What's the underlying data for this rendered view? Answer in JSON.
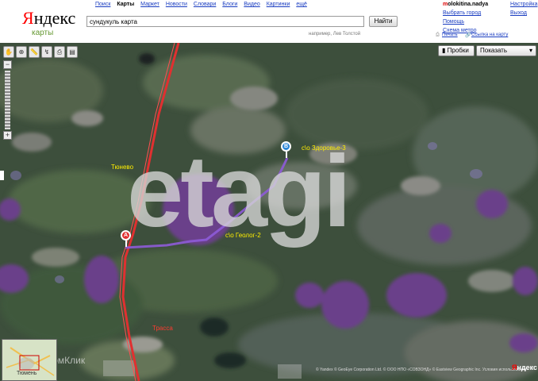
{
  "header": {
    "logo_text": "Яндекс",
    "logo_subtitle": "карты",
    "services": [
      {
        "label": "Поиск",
        "active": false
      },
      {
        "label": "Карты",
        "active": true
      },
      {
        "label": "Маркет",
        "active": false
      },
      {
        "label": "Новости",
        "active": false
      },
      {
        "label": "Словари",
        "active": false
      },
      {
        "label": "Блоги",
        "active": false
      },
      {
        "label": "Видео",
        "active": false
      },
      {
        "label": "Картинки",
        "active": false
      },
      {
        "label": "ещё",
        "active": false
      }
    ],
    "search_value": "сундукуль карта",
    "search_button": "Найти",
    "search_example": "например, Лев Толстой",
    "user_first_letter": "m",
    "user_rest": "olokitina.nadya",
    "links": {
      "settings": "Настройка",
      "exit": "Выход",
      "choose_city": "Выбрать город",
      "help": "Помощь",
      "metro": "Схема метро",
      "print": "Печать",
      "link_to_map": "Ссылка на карту"
    }
  },
  "map": {
    "layer_buttons": {
      "traffic": "Пробки",
      "show": "Показать"
    },
    "labels": [
      {
        "id": "zdorovye",
        "text": "с\\о Здоровье-3",
        "color": "#ffee00"
      },
      {
        "id": "tyunevo",
        "text": "Тюнево",
        "color": "#ffee00"
      },
      {
        "id": "geolog",
        "text": "с\\о Геолог-2",
        "color": "#ffee00"
      },
      {
        "id": "trassa",
        "text": "Трасса",
        "color": "#ff3b30"
      }
    ],
    "markers": [
      {
        "letter": "B",
        "color": "#2a86d6"
      },
      {
        "letter": "A",
        "color": "#e03030"
      }
    ],
    "copyright": "© Yandex  © GeoEye Corporation Ltd.  © ООО НПО «СОВЗОНД»  ©  Eastview Geographic Inc.  Условия использования",
    "yandex_logo_first": "Я",
    "yandex_logo_rest": "ндекс",
    "minimap_city": "Тюмень",
    "watermark": "etagi",
    "domklik": "ДомКлик"
  }
}
